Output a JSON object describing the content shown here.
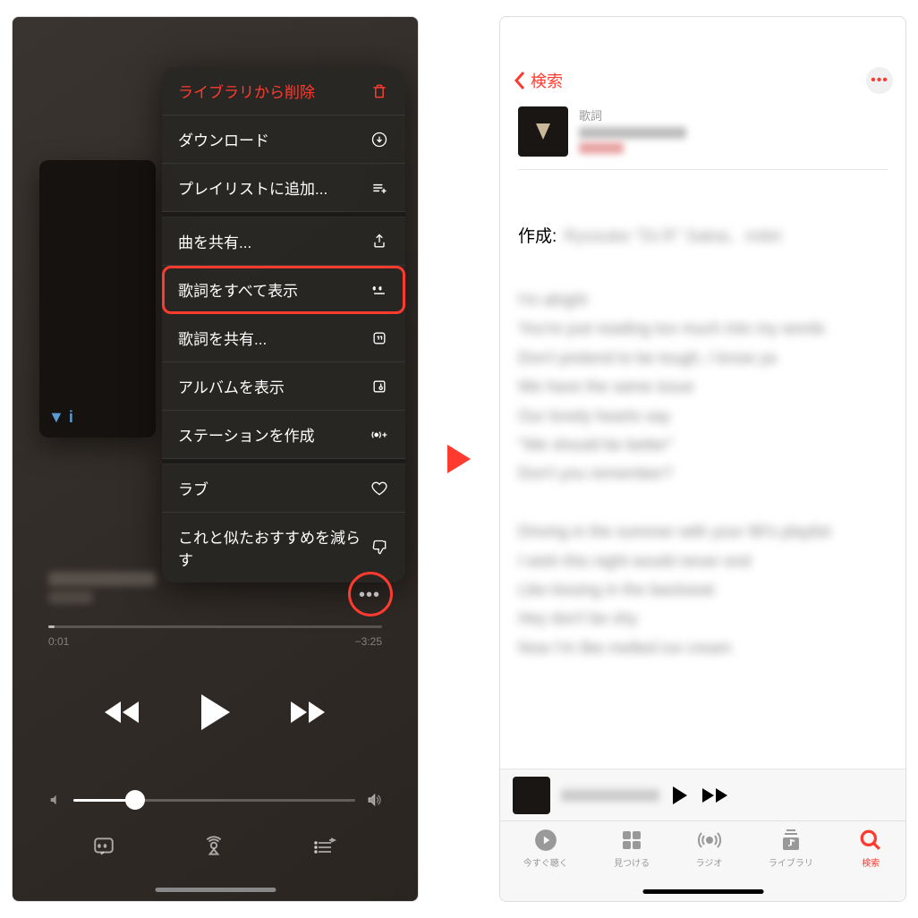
{
  "left": {
    "menu": {
      "delete": "ライブラリから削除",
      "download": "ダウンロード",
      "add_playlist": "プレイリストに追加...",
      "share_song": "曲を共有...",
      "show_lyrics": "歌詞をすべて表示",
      "share_lyrics": "歌詞を共有...",
      "show_album": "アルバムを表示",
      "create_station": "ステーションを作成",
      "love": "ラブ",
      "suggest_less": "これと似たおすすめを減らす"
    },
    "album_badge": "▼  i",
    "time_elapsed": "0:01",
    "time_remain": "−3:25"
  },
  "right": {
    "back_label": "検索",
    "lyrics_label": "歌詞",
    "credit_label": "作成:",
    "credit_value": "Ryosuke \"Dr.R\" Sakai、milet",
    "lyrics_body": "I'm alright\nYou're just reading too much into my words\nDon't pretend to be tough, I know ya\nWe have the same issue\nOur lonely hearts say\n\"We should be better\"\nDon't you remember?\n\nDriving in the summer with your 90's playlist\nI wish this night would never end\nLike kissing in the backseat\nHey don't be shy\nNow I'm like melted ice cream",
    "tabs": {
      "listen": "今すぐ聴く",
      "browse": "見つける",
      "radio": "ラジオ",
      "library": "ライブラリ",
      "search": "検索"
    }
  }
}
